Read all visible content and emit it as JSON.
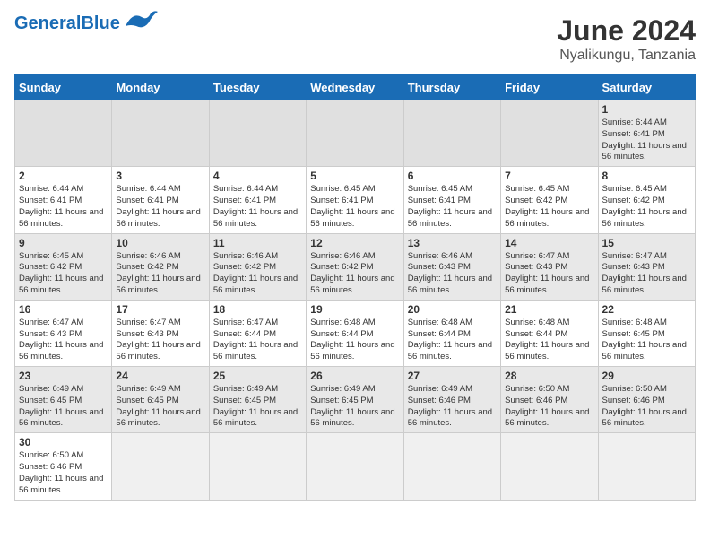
{
  "header": {
    "logo_general": "General",
    "logo_blue": "Blue",
    "title": "June 2024",
    "subtitle": "Nyalikungu, Tanzania"
  },
  "days_of_week": [
    "Sunday",
    "Monday",
    "Tuesday",
    "Wednesday",
    "Thursday",
    "Friday",
    "Saturday"
  ],
  "weeks": [
    [
      {
        "day": null,
        "empty": true
      },
      {
        "day": null,
        "empty": true
      },
      {
        "day": null,
        "empty": true
      },
      {
        "day": null,
        "empty": true
      },
      {
        "day": null,
        "empty": true
      },
      {
        "day": null,
        "empty": true
      },
      {
        "day": 1,
        "sunrise": "6:44 AM",
        "sunset": "6:41 PM",
        "daylight": "11 hours and 56 minutes."
      }
    ],
    [
      {
        "day": 2,
        "sunrise": "6:44 AM",
        "sunset": "6:41 PM",
        "daylight": "11 hours and 56 minutes."
      },
      {
        "day": 3,
        "sunrise": "6:44 AM",
        "sunset": "6:41 PM",
        "daylight": "11 hours and 56 minutes."
      },
      {
        "day": 4,
        "sunrise": "6:44 AM",
        "sunset": "6:41 PM",
        "daylight": "11 hours and 56 minutes."
      },
      {
        "day": 5,
        "sunrise": "6:45 AM",
        "sunset": "6:41 PM",
        "daylight": "11 hours and 56 minutes."
      },
      {
        "day": 6,
        "sunrise": "6:45 AM",
        "sunset": "6:41 PM",
        "daylight": "11 hours and 56 minutes."
      },
      {
        "day": 7,
        "sunrise": "6:45 AM",
        "sunset": "6:42 PM",
        "daylight": "11 hours and 56 minutes."
      },
      {
        "day": 8,
        "sunrise": "6:45 AM",
        "sunset": "6:42 PM",
        "daylight": "11 hours and 56 minutes."
      }
    ],
    [
      {
        "day": 9,
        "sunrise": "6:45 AM",
        "sunset": "6:42 PM",
        "daylight": "11 hours and 56 minutes."
      },
      {
        "day": 10,
        "sunrise": "6:46 AM",
        "sunset": "6:42 PM",
        "daylight": "11 hours and 56 minutes."
      },
      {
        "day": 11,
        "sunrise": "6:46 AM",
        "sunset": "6:42 PM",
        "daylight": "11 hours and 56 minutes."
      },
      {
        "day": 12,
        "sunrise": "6:46 AM",
        "sunset": "6:42 PM",
        "daylight": "11 hours and 56 minutes."
      },
      {
        "day": 13,
        "sunrise": "6:46 AM",
        "sunset": "6:43 PM",
        "daylight": "11 hours and 56 minutes."
      },
      {
        "day": 14,
        "sunrise": "6:47 AM",
        "sunset": "6:43 PM",
        "daylight": "11 hours and 56 minutes."
      },
      {
        "day": 15,
        "sunrise": "6:47 AM",
        "sunset": "6:43 PM",
        "daylight": "11 hours and 56 minutes."
      }
    ],
    [
      {
        "day": 16,
        "sunrise": "6:47 AM",
        "sunset": "6:43 PM",
        "daylight": "11 hours and 56 minutes."
      },
      {
        "day": 17,
        "sunrise": "6:47 AM",
        "sunset": "6:43 PM",
        "daylight": "11 hours and 56 minutes."
      },
      {
        "day": 18,
        "sunrise": "6:47 AM",
        "sunset": "6:44 PM",
        "daylight": "11 hours and 56 minutes."
      },
      {
        "day": 19,
        "sunrise": "6:48 AM",
        "sunset": "6:44 PM",
        "daylight": "11 hours and 56 minutes."
      },
      {
        "day": 20,
        "sunrise": "6:48 AM",
        "sunset": "6:44 PM",
        "daylight": "11 hours and 56 minutes."
      },
      {
        "day": 21,
        "sunrise": "6:48 AM",
        "sunset": "6:44 PM",
        "daylight": "11 hours and 56 minutes."
      },
      {
        "day": 22,
        "sunrise": "6:48 AM",
        "sunset": "6:45 PM",
        "daylight": "11 hours and 56 minutes."
      }
    ],
    [
      {
        "day": 23,
        "sunrise": "6:49 AM",
        "sunset": "6:45 PM",
        "daylight": "11 hours and 56 minutes."
      },
      {
        "day": 24,
        "sunrise": "6:49 AM",
        "sunset": "6:45 PM",
        "daylight": "11 hours and 56 minutes."
      },
      {
        "day": 25,
        "sunrise": "6:49 AM",
        "sunset": "6:45 PM",
        "daylight": "11 hours and 56 minutes."
      },
      {
        "day": 26,
        "sunrise": "6:49 AM",
        "sunset": "6:45 PM",
        "daylight": "11 hours and 56 minutes."
      },
      {
        "day": 27,
        "sunrise": "6:49 AM",
        "sunset": "6:46 PM",
        "daylight": "11 hours and 56 minutes."
      },
      {
        "day": 28,
        "sunrise": "6:50 AM",
        "sunset": "6:46 PM",
        "daylight": "11 hours and 56 minutes."
      },
      {
        "day": 29,
        "sunrise": "6:50 AM",
        "sunset": "6:46 PM",
        "daylight": "11 hours and 56 minutes."
      }
    ],
    [
      {
        "day": 30,
        "sunrise": "6:50 AM",
        "sunset": "6:46 PM",
        "daylight": "11 hours and 56 minutes."
      },
      {
        "day": null,
        "empty": true
      },
      {
        "day": null,
        "empty": true
      },
      {
        "day": null,
        "empty": true
      },
      {
        "day": null,
        "empty": true
      },
      {
        "day": null,
        "empty": true
      },
      {
        "day": null,
        "empty": true
      }
    ]
  ]
}
